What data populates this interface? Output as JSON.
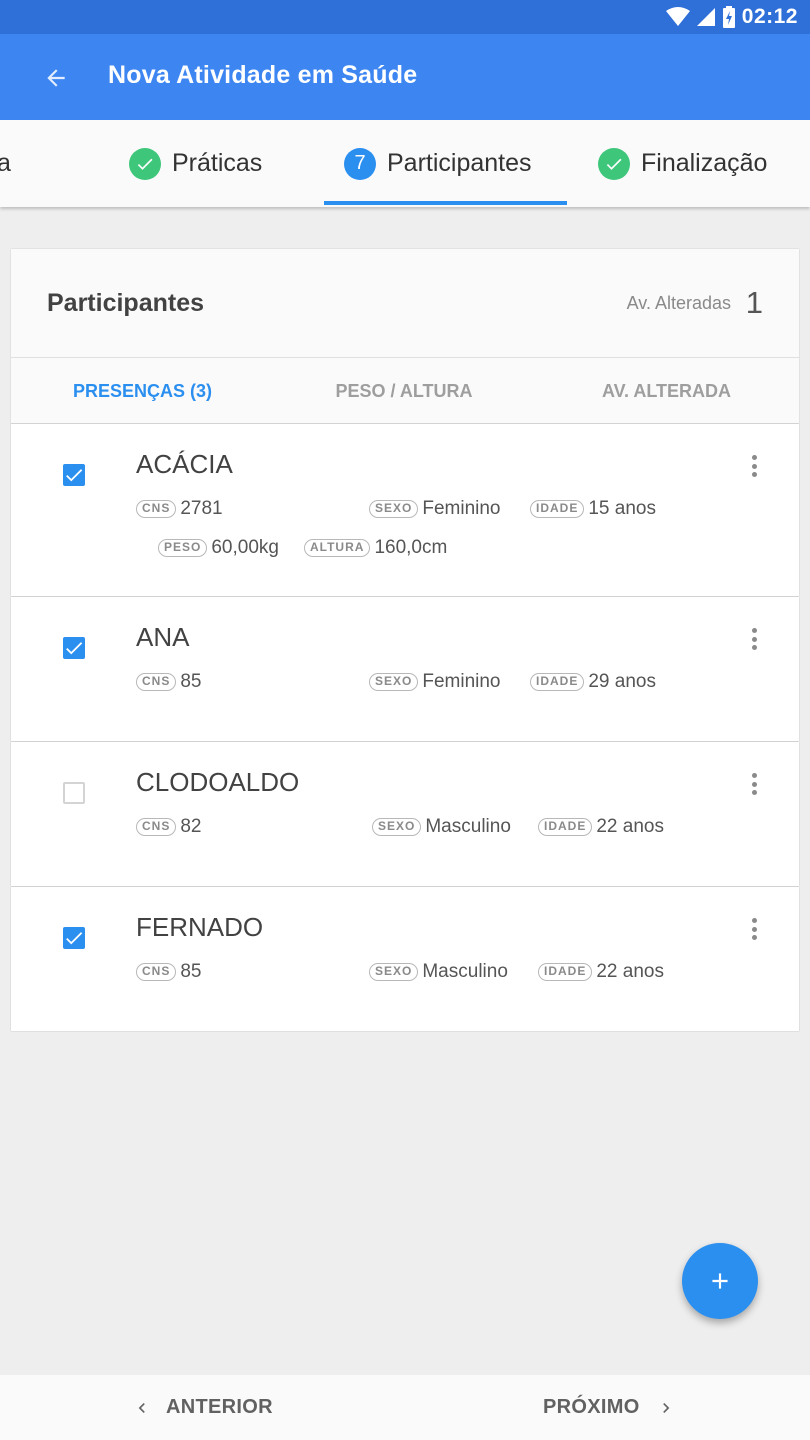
{
  "status_bar": {
    "time": "02:12"
  },
  "app_bar": {
    "title": "Nova Atividade em Saúde"
  },
  "stepper": {
    "partial_step": "a",
    "steps": [
      {
        "label": "Práticas",
        "icon": "check",
        "state": "done"
      },
      {
        "label": "Participantes",
        "number": "7",
        "state": "active"
      },
      {
        "label": "Finalização",
        "icon": "check",
        "state": "done"
      }
    ]
  },
  "card": {
    "title": "Participantes",
    "av_label": "Av. Alteradas",
    "av_count": "1"
  },
  "tabs": [
    {
      "label": "PRESENÇAS (3)",
      "active": true
    },
    {
      "label": "PESO / ALTURA",
      "active": false
    },
    {
      "label": "AV. ALTERADA",
      "active": false
    }
  ],
  "participants": [
    {
      "name": "ACÁCIA",
      "checked": true,
      "cns_tag": "CNS",
      "cns": "2781",
      "sexo_tag": "SEXO",
      "sexo": "Feminino",
      "idade_tag": "IDADE",
      "idade": "15 anos",
      "peso_tag": "PESO",
      "peso": "60,00kg",
      "altura_tag": "ALTURA",
      "altura": "160,0cm"
    },
    {
      "name": "ANA",
      "checked": true,
      "cns_tag": "CNS",
      "cns": "85",
      "sexo_tag": "SEXO",
      "sexo": "Feminino",
      "idade_tag": "IDADE",
      "idade": "29 anos"
    },
    {
      "name": "CLODOALDO",
      "checked": false,
      "cns_tag": "CNS",
      "cns": "82",
      "sexo_tag": "SEXO",
      "sexo": "Masculino",
      "idade_tag": "IDADE",
      "idade": "22 anos"
    },
    {
      "name": "FERNADO",
      "checked": true,
      "cns_tag": "CNS",
      "cns": "85",
      "sexo_tag": "SEXO",
      "sexo": "Masculino",
      "idade_tag": "IDADE",
      "idade": "22 anos"
    }
  ],
  "bottom_nav": {
    "prev": "ANTERIOR",
    "next": "PRÓXIMO"
  },
  "colors": {
    "primary": "#3d86f2",
    "status_bar": "#2f6fd8",
    "accent": "#2b8ff0",
    "success": "#3ec77b"
  }
}
